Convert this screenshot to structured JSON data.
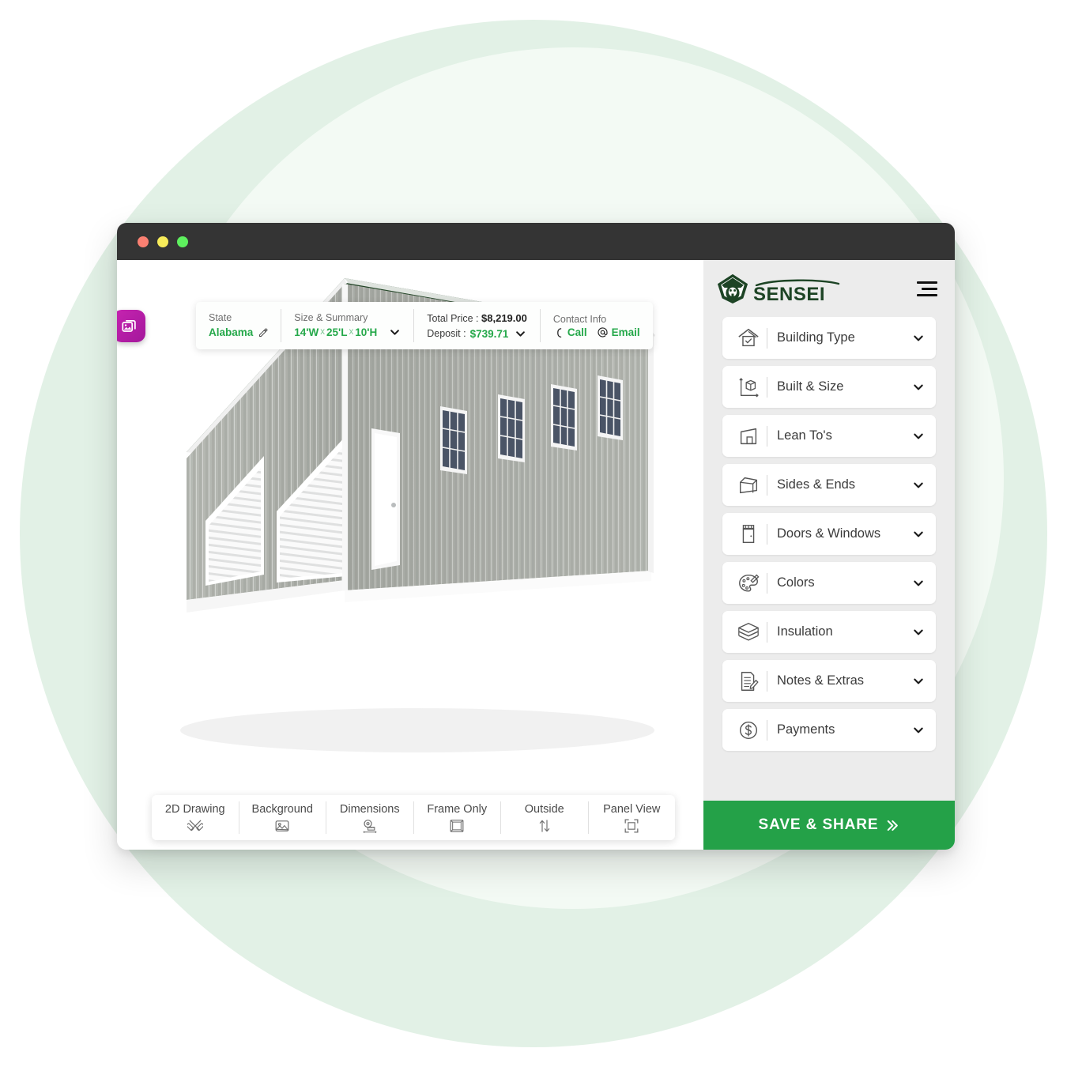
{
  "background": {
    "outer_circle_color": "#e2f1e6",
    "inner_circle_color": "#f3faf4"
  },
  "window": {
    "traffic_lights": [
      "close",
      "minimize",
      "maximize"
    ],
    "titlebar_color": "#343434"
  },
  "canvas": {
    "gallery_badge_icon": "image-gallery-icon",
    "gallery_badge_color": "#b71fa8"
  },
  "info_bar": {
    "state": {
      "label": "State",
      "value": "Alabama",
      "edit_icon": "pencil-icon"
    },
    "size_summary": {
      "label": "Size & Summary",
      "width": "14'W",
      "sep1": "x",
      "length": "25'L",
      "sep2": "x",
      "height": "10'H",
      "caret_icon": "chevron-down-icon"
    },
    "pricing": {
      "total_label": "Total Price :",
      "total_value": "$8,219.00",
      "deposit_label": "Deposit :",
      "deposit_value": "$739.71",
      "caret_icon": "chevron-down-icon"
    },
    "contact": {
      "label": "Contact Info",
      "call_label": "Call",
      "call_icon": "phone-icon",
      "email_label": "Email",
      "email_icon": "at-sign-icon"
    }
  },
  "building": {
    "roof_color": "#1e3d1f",
    "wall_color": "#a9aca6",
    "trim_color": "#f4f4f4",
    "window_glass_color": "#4a5466",
    "roll_up_doors": 2,
    "walk_in_doors": 1,
    "side_windows": 4
  },
  "view_toolbar": {
    "items": [
      {
        "label": "2D Drawing",
        "icon": "ruler-pencil-cross-icon"
      },
      {
        "label": "Background",
        "icon": "image-icon"
      },
      {
        "label": "Dimensions",
        "icon": "tape-measure-icon"
      },
      {
        "label": "Frame Only",
        "icon": "frame-box-icon"
      },
      {
        "label": "Outside",
        "icon": "up-down-arrows-icon"
      },
      {
        "label": "Panel View",
        "icon": "crop-frame-icon"
      }
    ]
  },
  "sidebar": {
    "logo": {
      "text": "SENSEI",
      "icon": "sensei-face-logo-icon",
      "color": "#1d4425"
    },
    "menu_icon": "hamburger-icon",
    "items": [
      {
        "label": "Building Type",
        "icon": "house-check-icon",
        "caret": "chevron-down-icon"
      },
      {
        "label": "Built & Size",
        "icon": "cube-axes-icon",
        "caret": "chevron-down-icon"
      },
      {
        "label": "Lean To's",
        "icon": "lean-to-icon",
        "caret": "chevron-down-icon"
      },
      {
        "label": "Sides & Ends",
        "icon": "panel-slab-icon",
        "caret": "chevron-down-icon"
      },
      {
        "label": "Doors & Windows",
        "icon": "door-window-icon",
        "caret": "chevron-down-icon"
      },
      {
        "label": "Colors",
        "icon": "paint-palette-icon",
        "caret": "chevron-down-icon"
      },
      {
        "label": "Insulation",
        "icon": "layers-icon",
        "caret": "chevron-down-icon"
      },
      {
        "label": "Notes & Extras",
        "icon": "note-pencil-icon",
        "caret": "chevron-down-icon"
      },
      {
        "label": "Payments",
        "icon": "dollar-circle-icon",
        "caret": "chevron-down-icon"
      }
    ],
    "save_share": {
      "label": "SAVE & SHARE",
      "icon": "double-chevron-right-icon",
      "color": "#24a148"
    }
  }
}
